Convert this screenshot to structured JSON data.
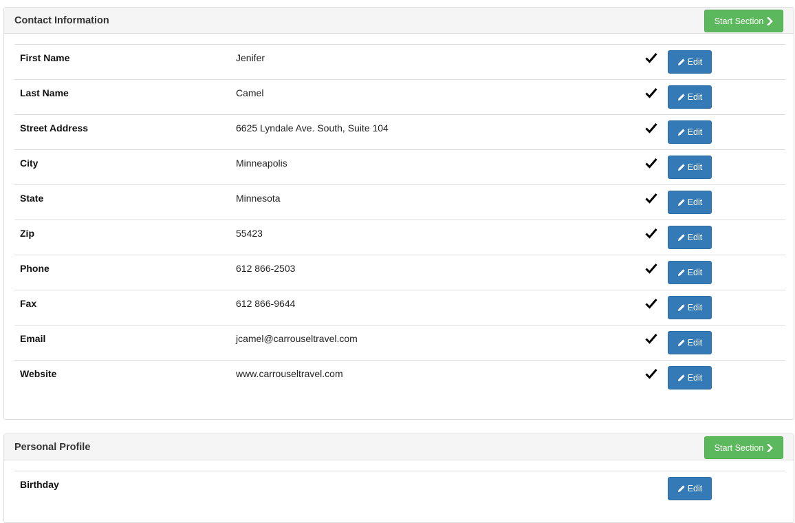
{
  "sections": [
    {
      "title": "Contact Information",
      "start_label": "Start Section",
      "rows": [
        {
          "label": "First Name",
          "value": "Jenifer",
          "complete": true,
          "edit_label": "Edit"
        },
        {
          "label": "Last Name",
          "value": "Camel",
          "complete": true,
          "edit_label": "Edit"
        },
        {
          "label": "Street Address",
          "value": "6625 Lyndale Ave. South, Suite 104",
          "complete": true,
          "edit_label": "Edit"
        },
        {
          "label": "City",
          "value": "Minneapolis",
          "complete": true,
          "edit_label": "Edit"
        },
        {
          "label": "State",
          "value": "Minnesota",
          "complete": true,
          "edit_label": "Edit"
        },
        {
          "label": "Zip",
          "value": "55423",
          "complete": true,
          "edit_label": "Edit"
        },
        {
          "label": "Phone",
          "value": "612 866-2503",
          "complete": true,
          "edit_label": "Edit"
        },
        {
          "label": "Fax",
          "value": "612 866-9644",
          "complete": true,
          "edit_label": "Edit"
        },
        {
          "label": "Email",
          "value": "jcamel@carrouseltravel.com",
          "complete": true,
          "edit_label": "Edit"
        },
        {
          "label": "Website",
          "value": "www.carrouseltravel.com",
          "complete": true,
          "edit_label": "Edit"
        }
      ]
    },
    {
      "title": "Personal Profile",
      "start_label": "Start Section",
      "rows": [
        {
          "label": "Birthday",
          "value": "",
          "complete": false,
          "edit_label": "Edit"
        }
      ]
    }
  ],
  "colors": {
    "start_button": "#5cb85c",
    "edit_button": "#337ab7",
    "panel_heading": "#f5f5f5"
  },
  "icons": {
    "start_button": "chevron-right-icon",
    "edit_button": "pencil-icon",
    "complete": "checkmark-icon"
  }
}
